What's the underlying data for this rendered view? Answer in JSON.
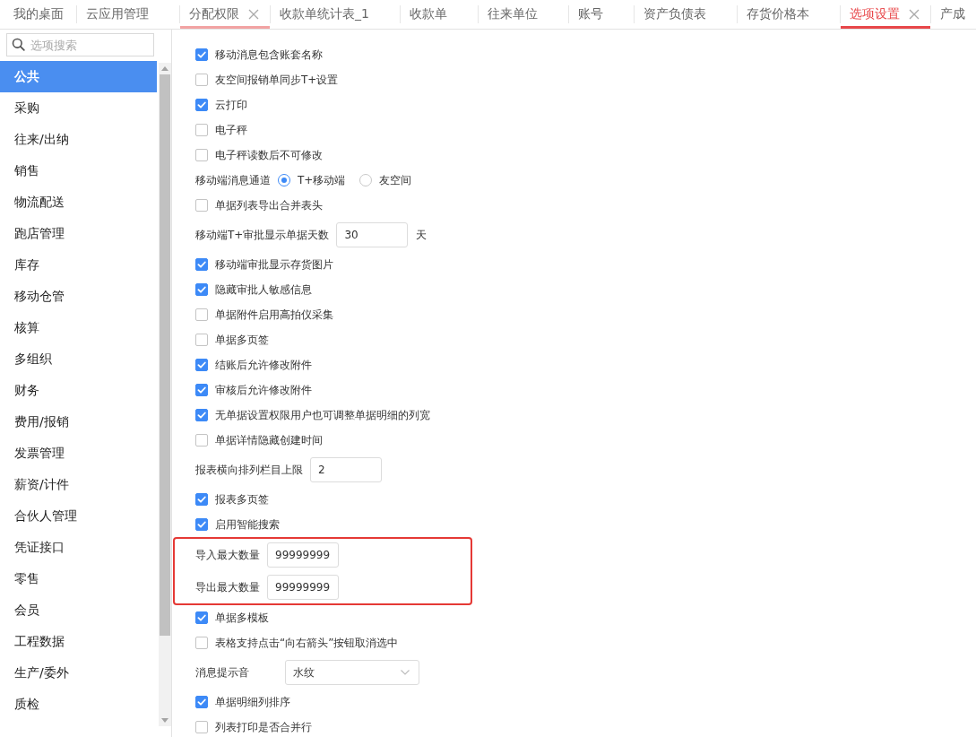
{
  "tabs": [
    {
      "kind": "home",
      "label": "我的桌面",
      "selected": false,
      "hovered": false,
      "show_close": false
    },
    {
      "kind": "page",
      "label": "云应用管理",
      "selected": false,
      "hovered": false,
      "show_close": false
    },
    {
      "kind": "page",
      "label": "分配权限",
      "selected": false,
      "hovered": true,
      "show_close": true
    },
    {
      "kind": "page",
      "label": "收款单统计表_1",
      "selected": false,
      "hovered": false,
      "show_close": false
    },
    {
      "kind": "page",
      "label": "收款单",
      "selected": false,
      "hovered": false,
      "show_close": false
    },
    {
      "kind": "page",
      "label": "往来单位",
      "selected": false,
      "hovered": false,
      "show_close": false
    },
    {
      "kind": "page",
      "label": "账号",
      "selected": false,
      "hovered": false,
      "show_close": false
    },
    {
      "kind": "page",
      "label": "资产负债表",
      "selected": false,
      "hovered": false,
      "show_close": false
    },
    {
      "kind": "page",
      "label": "存货价格本",
      "selected": false,
      "hovered": false,
      "show_close": false
    },
    {
      "kind": "page",
      "label": "选项设置",
      "selected": true,
      "hovered": false,
      "show_close": true
    },
    {
      "kind": "page",
      "label": "产成",
      "selected": false,
      "hovered": false,
      "show_close": false
    }
  ],
  "sidebar": {
    "search": {
      "placeholder": "选项搜索"
    },
    "items": [
      {
        "label": "公共",
        "selected": true
      },
      {
        "label": "采购",
        "selected": false
      },
      {
        "label": "往来/出纳",
        "selected": false
      },
      {
        "label": "销售",
        "selected": false
      },
      {
        "label": "物流配送",
        "selected": false
      },
      {
        "label": "跑店管理",
        "selected": false
      },
      {
        "label": "库存",
        "selected": false
      },
      {
        "label": "移动仓管",
        "selected": false
      },
      {
        "label": "核算",
        "selected": false
      },
      {
        "label": "多组织",
        "selected": false
      },
      {
        "label": "财务",
        "selected": false
      },
      {
        "label": "费用/报销",
        "selected": false
      },
      {
        "label": "发票管理",
        "selected": false
      },
      {
        "label": "薪资/计件",
        "selected": false
      },
      {
        "label": "合伙人管理",
        "selected": false
      },
      {
        "label": "凭证接口",
        "selected": false
      },
      {
        "label": "零售",
        "selected": false
      },
      {
        "label": "会员",
        "selected": false
      },
      {
        "label": "工程数据",
        "selected": false
      },
      {
        "label": "生产/委外",
        "selected": false
      },
      {
        "label": "质检",
        "selected": false
      }
    ]
  },
  "options": [
    {
      "kind": "checkbox",
      "label": "移动消息包含账套名称",
      "checked": true
    },
    {
      "kind": "checkbox",
      "label": "友空间报销单同步T+设置",
      "checked": false
    },
    {
      "kind": "checkbox",
      "label": "云打印",
      "checked": true
    },
    {
      "kind": "checkbox",
      "label": "电子秤",
      "checked": false
    },
    {
      "kind": "checkbox",
      "label": "电子秤读数后不可修改",
      "checked": false
    },
    {
      "kind": "radio",
      "label": "移动端消息通道",
      "options": [
        {
          "label": "T+移动端",
          "selected": true
        },
        {
          "label": "友空间",
          "selected": false
        }
      ]
    },
    {
      "kind": "checkbox",
      "label": "单据列表导出合并表头",
      "checked": false
    },
    {
      "kind": "number",
      "label": "移动端T+审批显示单据天数",
      "value": "30",
      "unit": "天"
    },
    {
      "kind": "checkbox",
      "label": "移动端审批显示存货图片",
      "checked": true
    },
    {
      "kind": "checkbox",
      "label": "隐藏审批人敏感信息",
      "checked": true
    },
    {
      "kind": "checkbox",
      "label": "单据附件启用高拍仪采集",
      "checked": false
    },
    {
      "kind": "checkbox",
      "label": "单据多页签",
      "checked": false
    },
    {
      "kind": "checkbox",
      "label": "结账后允许修改附件",
      "checked": true
    },
    {
      "kind": "checkbox",
      "label": "审核后允许修改附件",
      "checked": true
    },
    {
      "kind": "checkbox",
      "label": "无单据设置权限用户也可调整单据明细的列宽",
      "checked": true
    },
    {
      "kind": "checkbox",
      "label": "单据详情隐藏创建时间",
      "checked": false
    },
    {
      "kind": "number",
      "label": "报表横向排列栏目上限",
      "value": "2"
    },
    {
      "kind": "checkbox",
      "label": "报表多页签",
      "checked": true
    },
    {
      "kind": "checkbox",
      "label": "启用智能搜索",
      "checked": true
    },
    {
      "kind": "frame",
      "items": [
        {
          "kind": "number",
          "label": "导入最大数量",
          "value": "99999999"
        },
        {
          "kind": "number",
          "label": "导出最大数量",
          "value": "99999999"
        }
      ]
    },
    {
      "kind": "checkbox",
      "label": "单据多模板",
      "checked": true
    },
    {
      "kind": "checkbox",
      "label": "表格支持点击“向右箭头”按钮取消选中",
      "checked": false
    },
    {
      "kind": "select",
      "label": "消息提示音",
      "value": "水纹"
    },
    {
      "kind": "checkbox",
      "label": "单据明细列排序",
      "checked": true
    },
    {
      "kind": "checkbox",
      "label": "列表打印是否合并行",
      "checked": false
    }
  ]
}
